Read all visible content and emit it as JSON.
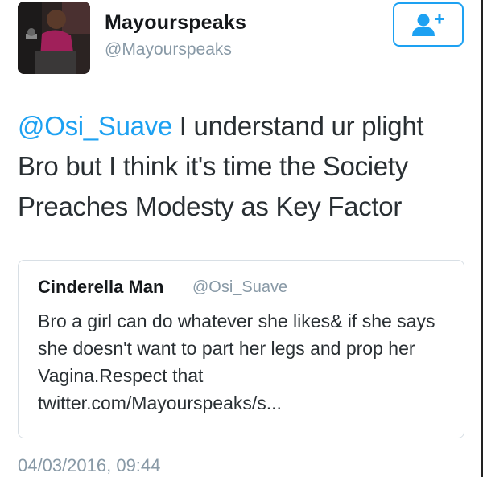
{
  "user": {
    "name": "Mayourspeaks",
    "handle": "@Mayourspeaks"
  },
  "follow_button": {
    "icon": "follow-user-plus-icon",
    "color": "#1da1f2"
  },
  "tweet": {
    "mention": "@Osi_Suave",
    "text": " I understand ur plight Bro but I think it's time the Society Preaches Modesty as Key Factor"
  },
  "quoted_tweet": {
    "name": "Cinderella Man",
    "handle": "@Osi_Suave",
    "text": "Bro a girl can do whatever she likes& if she says she doesn't want to part her legs and prop her Vagina.Respect that twitter.com/Mayourspeaks/s..."
  },
  "timestamp": "04/03/2016, 09:44",
  "colors": {
    "link": "#1da1f2",
    "muted": "#8899a6",
    "text": "#292f33",
    "border": "#d8dfe5"
  }
}
